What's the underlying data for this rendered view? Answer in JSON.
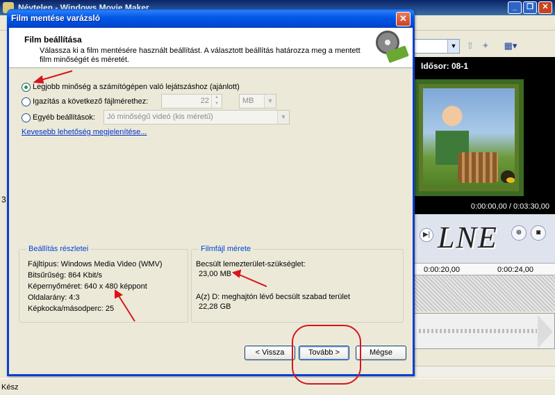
{
  "app": {
    "title": "Névtelen - Windows Movie Maker",
    "window_buttons": [
      "_",
      "❐",
      "✕"
    ],
    "preview_title": "Idősor: 08-1",
    "time_readout": "0:00:00,00 / 0:03:30,00",
    "ruler_marks": [
      "0:00:20,00",
      "0:00:24,00"
    ],
    "watermark": "LNE",
    "status": "Kész",
    "left_digit": "3"
  },
  "dialog": {
    "title": "Film mentése varázsló",
    "close": "✕",
    "header_title": "Film beállítása",
    "header_desc": "Válassza ki a film mentésére használt beállítást. A választott beállítás határozza meg a mentett film minőségét és méretét.",
    "options": [
      {
        "label": "Legjobb minőség a számítógépen való lejátszáshoz (ajánlott)",
        "checked": true
      },
      {
        "label": "Igazítás a következő fájlmérethez:",
        "checked": false
      },
      {
        "label": "Egyéb beállítások:",
        "checked": false
      }
    ],
    "size_value": "22",
    "size_unit": "MB",
    "other_setting": "Jó minőségű videó (kis méretű)",
    "fewer_options_link": "Kevesebb lehetőség megjelenítése...",
    "settings_group": {
      "title": "Beállítás részletei",
      "lines": [
        "Fájltípus: Windows Media Video (WMV)",
        "Bitsűrűség: 864 Kbit/s",
        "Képernyőméret: 640 x 480 képpont",
        "Oldalarány: 4:3",
        "Képkocka/másodperc: 25"
      ]
    },
    "file_group": {
      "title": "Filmfájl mérete",
      "estimate_label": "Becsült lemezterület-szükséglet:",
      "estimate_value": "23,00 MB",
      "free_label": "A(z) D: meghajtón lévő becsült szabad terület",
      "free_value": "22,28 GB"
    },
    "buttons": {
      "back": "< Vissza",
      "next": "Tovább >",
      "cancel": "Mégse"
    }
  },
  "colors": {
    "title_blue": "#0058e6",
    "group_title": "#0046d5",
    "link": "#0033cc",
    "annotation_red": "#d8141c"
  }
}
